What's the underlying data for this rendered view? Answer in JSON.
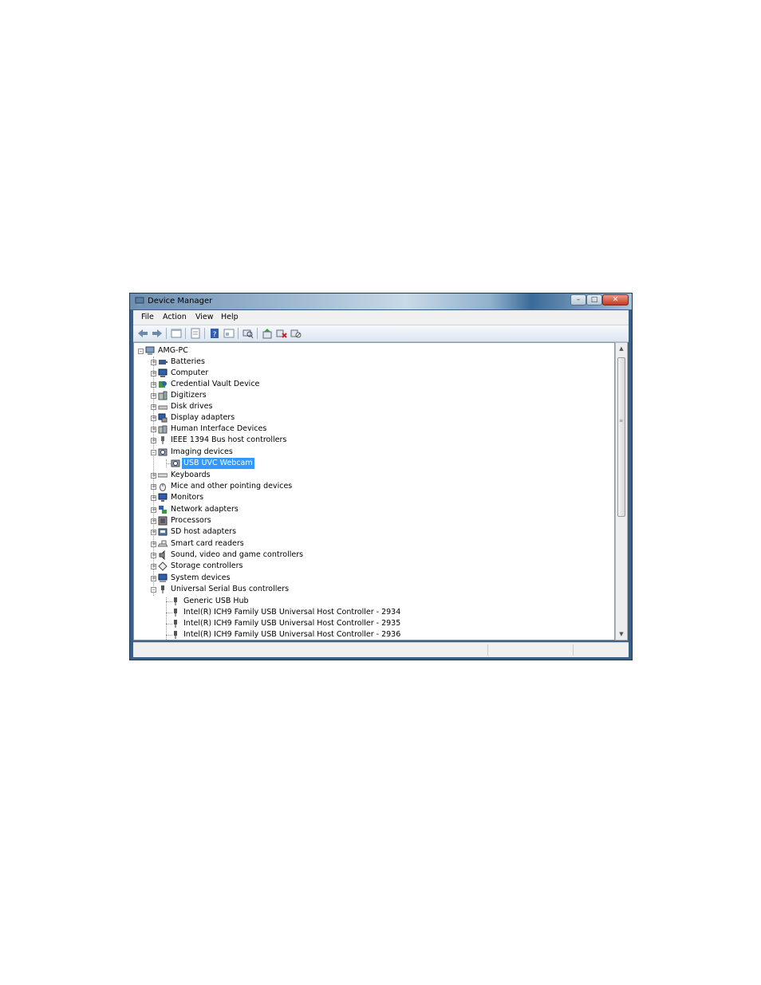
{
  "window": {
    "title": "Device Manager",
    "title_icon": "computer-manage-icon"
  },
  "menu": {
    "items": [
      "File",
      "Action",
      "View",
      "Help"
    ]
  },
  "toolbar": {
    "buttons": [
      "back-icon",
      "forward-icon",
      "show-hide-tree-icon",
      "properties-icon",
      "help-icon",
      "view-icon",
      "scan-hardware-icon",
      "update-driver-icon",
      "uninstall-icon",
      "disable-icon"
    ]
  },
  "tree": {
    "root": "AMG-PC",
    "categories": [
      {
        "label": "Batteries",
        "icon": "battery-icon",
        "expanded": false
      },
      {
        "label": "Computer",
        "icon": "computer-icon",
        "expanded": false
      },
      {
        "label": "Credential Vault Device",
        "icon": "credential-icon",
        "expanded": false
      },
      {
        "label": "Digitizers",
        "icon": "digitizer-icon",
        "expanded": false
      },
      {
        "label": "Disk drives",
        "icon": "disk-drive-icon",
        "expanded": false
      },
      {
        "label": "Display adapters",
        "icon": "display-adapter-icon",
        "expanded": false
      },
      {
        "label": "Human Interface Devices",
        "icon": "hid-icon",
        "expanded": false
      },
      {
        "label": "IEEE 1394 Bus host controllers",
        "icon": "ieee1394-icon",
        "expanded": false
      },
      {
        "label": "Imaging devices",
        "icon": "camera-icon",
        "expanded": true,
        "children": [
          "USB UVC Webcam"
        ]
      },
      {
        "label": "Keyboards",
        "icon": "keyboard-icon",
        "expanded": false
      },
      {
        "label": "Mice and other pointing devices",
        "icon": "mouse-icon",
        "expanded": false
      },
      {
        "label": "Monitors",
        "icon": "monitor-icon",
        "expanded": false
      },
      {
        "label": "Network adapters",
        "icon": "network-icon",
        "expanded": false
      },
      {
        "label": "Processors",
        "icon": "processor-icon",
        "expanded": false
      },
      {
        "label": "SD host adapters",
        "icon": "sd-card-icon",
        "expanded": false
      },
      {
        "label": "Smart card readers",
        "icon": "smart-card-icon",
        "expanded": false
      },
      {
        "label": "Sound, video and game controllers",
        "icon": "speaker-icon",
        "expanded": false
      },
      {
        "label": "Storage controllers",
        "icon": "storage-icon",
        "expanded": false
      },
      {
        "label": "System devices",
        "icon": "system-icon",
        "expanded": false
      },
      {
        "label": "Universal Serial Bus controllers",
        "icon": "usb-icon",
        "expanded": true,
        "children": [
          "Generic USB Hub",
          "Intel(R) ICH9 Family USB Universal Host Controller - 2934",
          "Intel(R) ICH9 Family USB Universal Host Controller - 2935",
          "Intel(R) ICH9 Family USB Universal Host Controller - 2936"
        ]
      }
    ],
    "selected": "USB UVC Webcam"
  },
  "colors": {
    "selection": "#3399ff",
    "frame": "#3b5f86"
  }
}
